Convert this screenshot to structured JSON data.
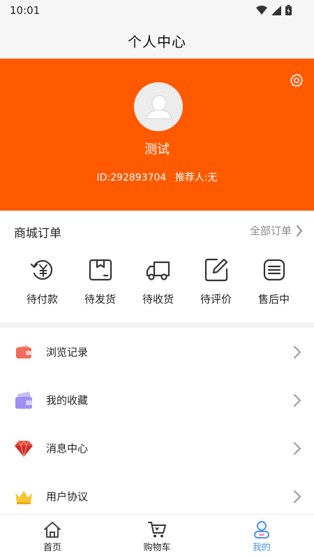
{
  "status_bar": {
    "time": "10:01"
  },
  "header": {
    "title": "个人中心"
  },
  "profile": {
    "username": "测试",
    "id_text": "ID:292893704",
    "referrer_text": "推荐人:无"
  },
  "orders": {
    "title": "商城订单",
    "all_orders_label": "全部订单",
    "items": [
      {
        "label": "待付款",
        "icon": "yen-refresh-icon"
      },
      {
        "label": "待发货",
        "icon": "package-box-icon"
      },
      {
        "label": "待收货",
        "icon": "delivery-truck-icon"
      },
      {
        "label": "待评价",
        "icon": "edit-pen-icon"
      },
      {
        "label": "售后中",
        "icon": "list-card-icon"
      }
    ]
  },
  "menu": {
    "items": [
      {
        "label": "浏览记录",
        "icon": "wallet-icon",
        "color": "#f26b5b"
      },
      {
        "label": "我的收藏",
        "icon": "card-wallet-icon",
        "color": "#9f8ef7"
      },
      {
        "label": "消息中心",
        "icon": "diamond-icon",
        "color": "#e8483b"
      },
      {
        "label": "用户协议",
        "icon": "crown-icon",
        "color": "#f7c531"
      }
    ]
  },
  "bottom_nav": {
    "items": [
      {
        "label": "首页",
        "icon": "home-icon"
      },
      {
        "label": "购物车",
        "icon": "cart-icon"
      },
      {
        "label": "我的",
        "icon": "user-icon"
      }
    ],
    "active_index": 2
  },
  "colors": {
    "brand": "#ff5a00",
    "active_nav": "#4a8ff5"
  }
}
